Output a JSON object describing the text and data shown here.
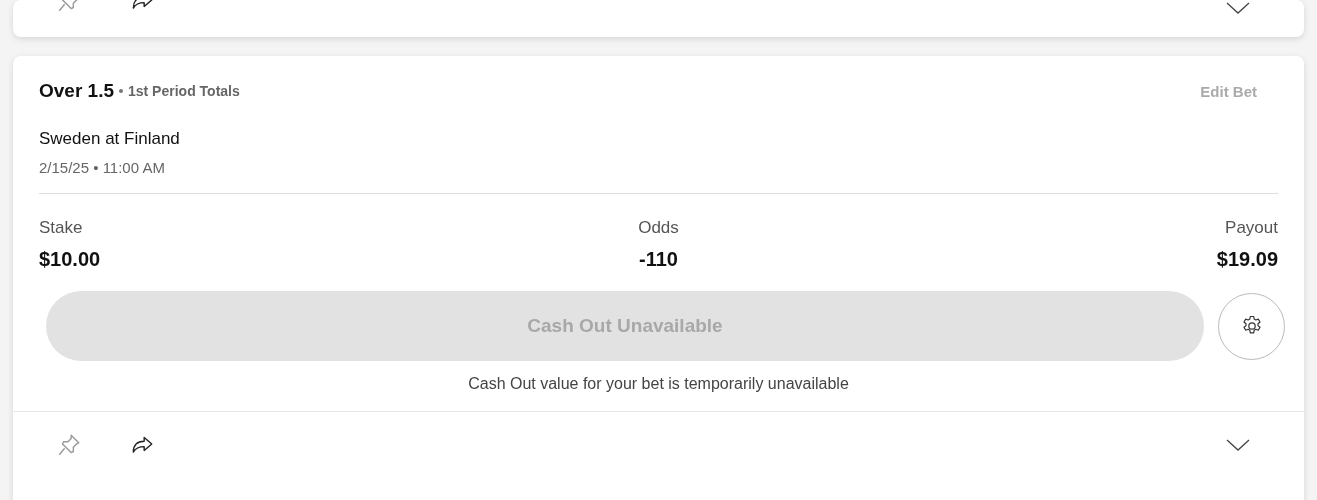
{
  "previous_bet": {
    "pinned": false
  },
  "bet": {
    "selection": "Over 1.5",
    "market": "1st Period Totals",
    "edit_label": "Edit Bet",
    "event": "Sweden at Finland",
    "date_time": "2/15/25 • 11:00 AM",
    "stats": [
      {
        "label": "Stake",
        "value": "$10.00"
      },
      {
        "label": "Odds",
        "value": "-110"
      },
      {
        "label": "Payout",
        "value": "$19.09"
      }
    ],
    "cash_out": {
      "label": "Cash Out Unavailable",
      "disabled": true
    },
    "cash_out_note": "Cash Out value for your bet is temporarily unavailable",
    "pinned": false
  }
}
